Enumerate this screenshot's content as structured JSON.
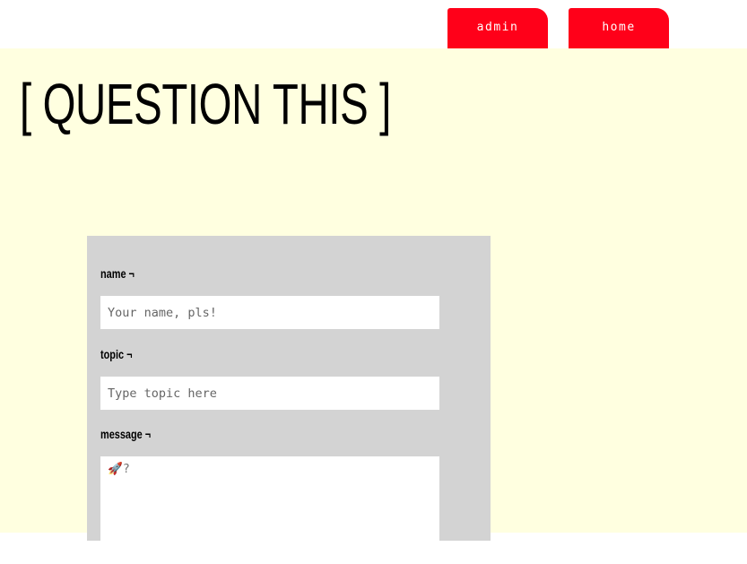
{
  "nav": {
    "admin_label": "admin",
    "home_label": "home"
  },
  "page": {
    "title": "[ QUESTION THIS ]"
  },
  "form": {
    "name_label": "name ¬",
    "name_placeholder": "Your name, pls!",
    "topic_label": "topic ¬",
    "topic_placeholder": "Type topic here",
    "message_label": "message ¬",
    "message_placeholder": "🚀?"
  },
  "colors": {
    "accent": "#ff0019",
    "background": "#ffffe0",
    "panel": "#d3d3d3"
  }
}
